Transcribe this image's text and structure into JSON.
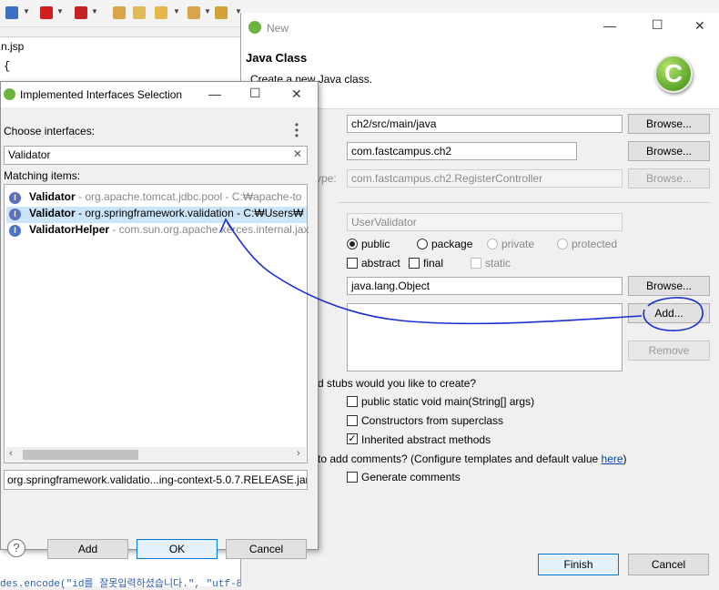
{
  "editor": {
    "tab": "n.jsp",
    "line1": "{",
    "bottom_code": "des.encode(\"id를 잘못입력하셨습니다.\", \"utf-8"
  },
  "new_class_dialog": {
    "title": "New",
    "heading": "Java Class",
    "subtitle": "Create a new Java class.",
    "source_folder": "ch2/src/main/java",
    "package": "com.fastcampus.ch2",
    "enclosing_type_label_fragment": "ype:",
    "enclosing_type": "com.fastcampus.ch2.RegisterController",
    "name": "UserValidator",
    "browse": "Browse...",
    "modifiers": {
      "public": "public",
      "package": "package",
      "private": "private",
      "protected": "protected",
      "abstract": "abstract",
      "final": "final",
      "static": "static"
    },
    "superclass": "java.lang.Object",
    "add": "Add...",
    "remove": "Remove",
    "stubs_question": "d stubs would you like to create?",
    "stub_main": "public static void main(String[] args)",
    "stub_constructors": "Constructors from superclass",
    "stub_inherited": "Inherited abstract methods",
    "comments_question": "to add comments? (Configure templates and default value ",
    "comments_link": "here",
    "comments_close": ")",
    "generate_comments": "Generate comments",
    "finish": "Finish",
    "cancel": "Cancel"
  },
  "interfaces_dialog": {
    "title": "Implemented Interfaces Selection",
    "choose_label": "Choose interfaces:",
    "filter_value": "Validator",
    "matching_label": "Matching items:",
    "items": [
      {
        "name": "Validator",
        "detail": " - org.apache.tomcat.jdbc.pool - C:₩apache-to"
      },
      {
        "name": "Validator",
        "detail": " - org.springframework.validation - C:₩Users₩"
      },
      {
        "name": "ValidatorHelper",
        "detail": " - com.sun.org.apache.xerces.internal.jax"
      }
    ],
    "path": "org.springframework.validatio...ing-context-5.0.7.RELEASE.jar",
    "add": "Add",
    "ok": "OK",
    "cancel": "Cancel"
  },
  "colors": {
    "annotation": "#1a2fd0",
    "selection": "#cce4f7",
    "spring_green": "#6db33f"
  }
}
